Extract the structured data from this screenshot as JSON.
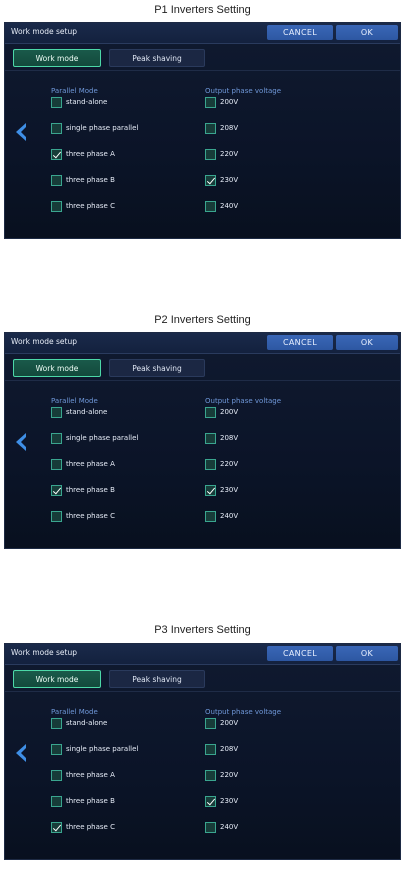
{
  "sections": [
    {
      "title": "P1 Inverters Setting",
      "parallel_selected": 2,
      "voltage_selected": 3
    },
    {
      "title": "P2 Inverters Setting",
      "parallel_selected": 3,
      "voltage_selected": 3
    },
    {
      "title": "P3 Inverters Setting",
      "parallel_selected": 4,
      "voltage_selected": 3
    }
  ],
  "panel": {
    "title": "Work mode setup",
    "cancel": "CANCEL",
    "ok": "OK",
    "tabs": [
      "Work mode",
      "Peak shaving"
    ],
    "parallel_header": "Parallel Mode",
    "parallel_options": [
      "stand-alone",
      "single phase parallel",
      "three phase A",
      "three phase B",
      "three phase C"
    ],
    "voltage_header": "Output phase voltage",
    "voltage_options": [
      "200V",
      "208V",
      "220V",
      "230V",
      "240V"
    ]
  },
  "colors": {
    "accent_green": "#4cd8a8",
    "button_blue": "#3a67b7",
    "panel_bg": "#0b1428",
    "back_arrow": "#3f8fe6"
  },
  "icons": {
    "back": "chevron-left-icon",
    "check": "checkmark-icon"
  }
}
